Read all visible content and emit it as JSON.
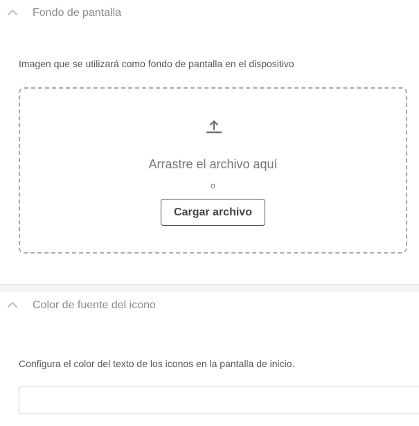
{
  "sections": [
    {
      "title": "Fondo de pantalla",
      "description": "Imagen que se utilizará como fondo de pantalla en el dispositivo",
      "dropzone": {
        "drag_text": "Arrastre el archivo aquí",
        "or_text": "o",
        "upload_button_label": "Cargar archivo"
      }
    },
    {
      "title": "Color de fuente del icono",
      "description": "Configura el color del texto de los iconos en la pantalla de inicio.",
      "input_value": ""
    }
  ],
  "icons": {
    "collapse": "chevron-up-icon",
    "upload": "upload-icon"
  },
  "colors": {
    "background": "#ffffff",
    "section_gap": "#f3f3f6",
    "title": "#8a8a8a",
    "text": "#555555",
    "dashed_border": "#a9a9a9"
  }
}
